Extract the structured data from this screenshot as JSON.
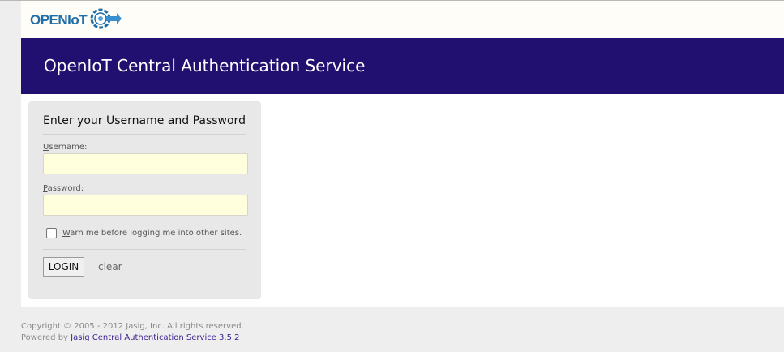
{
  "header": {
    "logo_text": "OPENIoT",
    "banner_title": "OpenIoT Central Authentication Service"
  },
  "login": {
    "heading": "Enter your Username and Password",
    "username": {
      "label_first": "U",
      "label_rest": "sername:",
      "value": ""
    },
    "password": {
      "label_first": "P",
      "label_rest": "assword:",
      "value": ""
    },
    "warn": {
      "checked": false,
      "label_first": "W",
      "label_rest": "arn me before logging me into other sites."
    },
    "login_button": "LOGIN",
    "clear_link": "clear"
  },
  "footer": {
    "copyright": "Copyright © 2005 - 2012 Jasig, Inc. All rights reserved.",
    "powered_prefix": "Powered by ",
    "powered_link": "Jasig Central Authentication Service 3.5.2"
  },
  "colors": {
    "banner": "#21106f",
    "logo_blue": "#1f6ea8",
    "input_bg": "#ffffdd",
    "box_bg": "#e8e8e8"
  }
}
